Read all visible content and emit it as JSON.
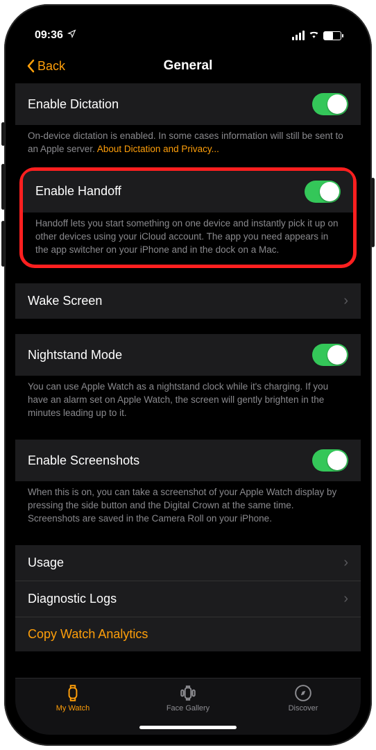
{
  "status": {
    "time": "09:36"
  },
  "nav": {
    "back": "Back",
    "title": "General"
  },
  "dictation": {
    "label": "Enable Dictation",
    "footer_a": "On-device dictation is enabled. In some cases information will still be sent to an Apple server. ",
    "footer_link": "About Dictation and Privacy..."
  },
  "handoff": {
    "label": "Enable Handoff",
    "footer": "Handoff lets you start something on one device and instantly pick it up on other devices using your iCloud account. The app you need appears in the app switcher on your iPhone and in the dock on a Mac."
  },
  "wake": {
    "label": "Wake Screen"
  },
  "nightstand": {
    "label": "Nightstand Mode",
    "footer": "You can use Apple Watch as a nightstand clock while it's charging. If you have an alarm set on Apple Watch, the screen will gently brighten in the minutes leading up to it."
  },
  "screenshots": {
    "label": "Enable Screenshots",
    "footer": "When this is on, you can take a screenshot of your Apple Watch display by pressing the side button and the Digital Crown at the same time. Screenshots are saved in the Camera Roll on your iPhone."
  },
  "usage": {
    "label": "Usage"
  },
  "diag": {
    "label": "Diagnostic Logs"
  },
  "copy": {
    "label": "Copy Watch Analytics"
  },
  "tabs": {
    "mywatch": "My Watch",
    "gallery": "Face Gallery",
    "discover": "Discover"
  }
}
